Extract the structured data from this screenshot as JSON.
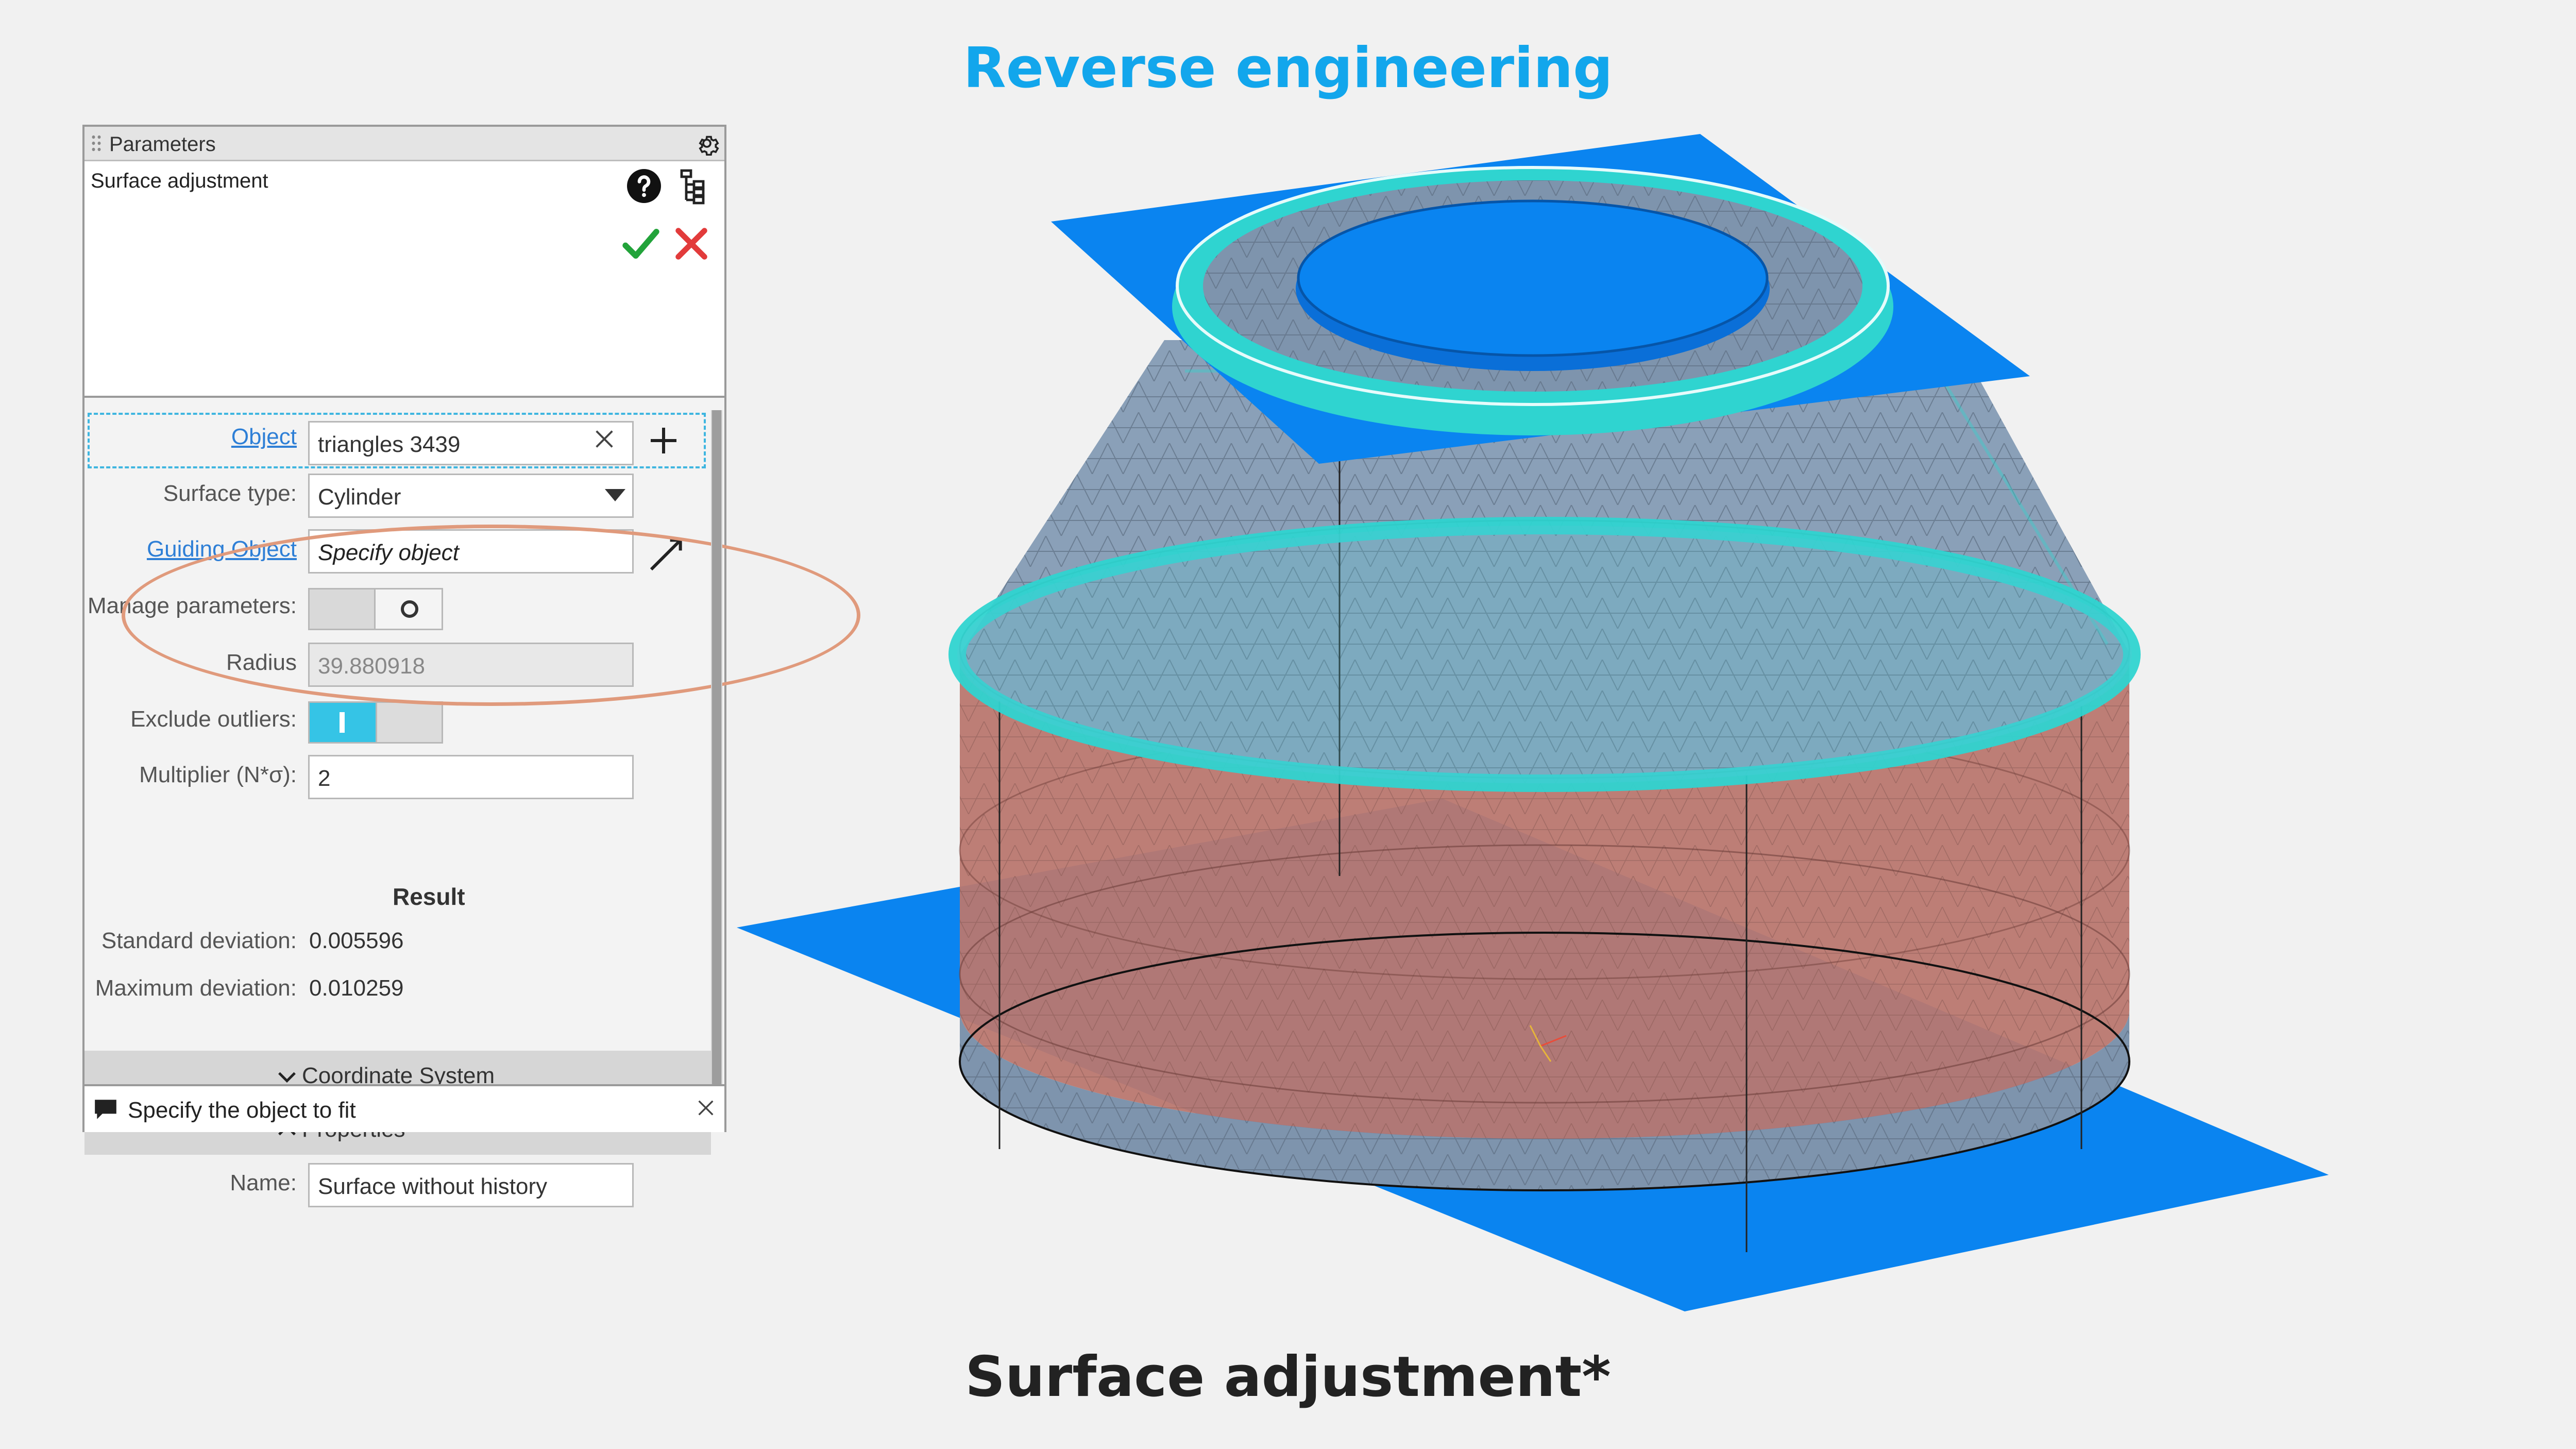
{
  "slide": {
    "title_top": "Reverse engineering",
    "title_bottom": "Surface adjustment*"
  },
  "panel": {
    "header_title": "Parameters",
    "command_name": "Surface adjustment",
    "fields": {
      "object": {
        "label": "Object",
        "value": "triangles 3439"
      },
      "surface_type": {
        "label": "Surface type:",
        "value": "Cylinder"
      },
      "guiding_object": {
        "label": "Guiding Object",
        "value": "Specify object"
      },
      "manage_parameters": {
        "label": "Manage parameters:"
      },
      "radius": {
        "label": "Radius",
        "value": "39.880918"
      },
      "exclude_outliers": {
        "label": "Exclude outliers:"
      },
      "multiplier": {
        "label": "Multiplier (N*σ):",
        "value": "2"
      }
    },
    "result": {
      "title": "Result",
      "std_label": "Standard deviation:",
      "std_value": "0.005596",
      "max_label": "Maximum deviation:",
      "max_value": "0.010259"
    },
    "sections": {
      "coordinate_system": "Coordinate System",
      "properties": "Properties"
    },
    "name": {
      "label": "Name:",
      "value": "Surface without history"
    },
    "status_text": "Specify the object to fit"
  },
  "colors": {
    "accent_blue": "#12a6ec",
    "plane_blue": "#0a84f0",
    "fit_cyan": "#2fd4d0",
    "mesh_gray_blue": "#7e94ad",
    "cylinder_red": "#b9776f",
    "highlight_orange": "#e09a7c"
  }
}
